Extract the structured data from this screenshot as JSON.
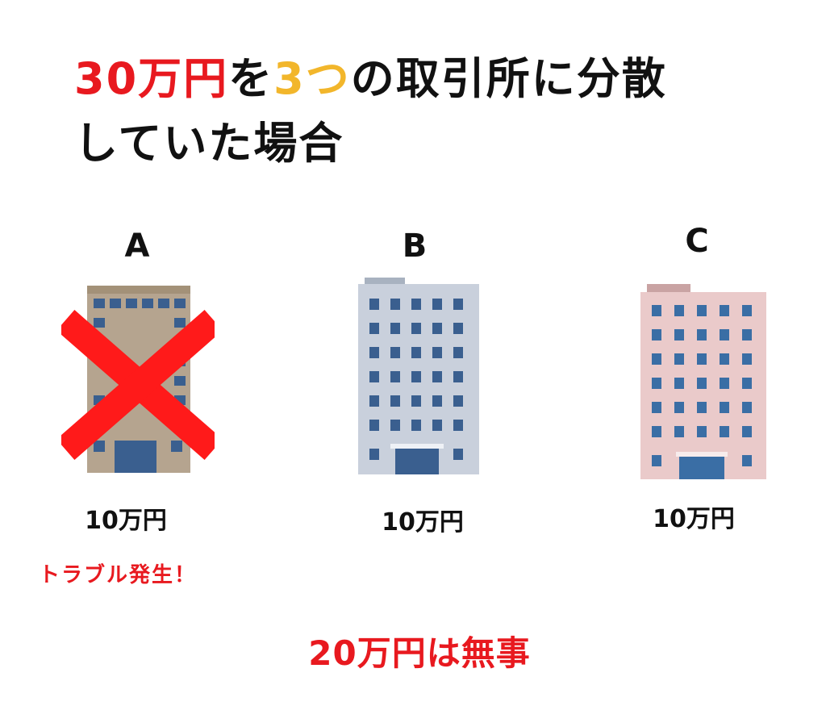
{
  "title": {
    "part1": "30万円",
    "part2": "を",
    "part3": "3つ",
    "part4": "の取引所に分散",
    "line2": "していた場合"
  },
  "exchanges": [
    {
      "label": "A",
      "amount": "10万円",
      "status": "crossed-out"
    },
    {
      "label": "B",
      "amount": "10万円",
      "status": "ok"
    },
    {
      "label": "C",
      "amount": "10万円",
      "status": "ok"
    }
  ],
  "trouble_text": "トラブル発生！",
  "result_text": "20万円は無事",
  "colors": {
    "accent_red": "#e8191f",
    "accent_yellow": "#f2b62b",
    "building_a": "#b5a48f",
    "building_b": "#c9d0dc",
    "building_c": "#eacaca",
    "window": "#3a6ea5",
    "cross": "#ff1a1a"
  },
  "icons": [
    "building-icon",
    "cross-mark-icon"
  ]
}
